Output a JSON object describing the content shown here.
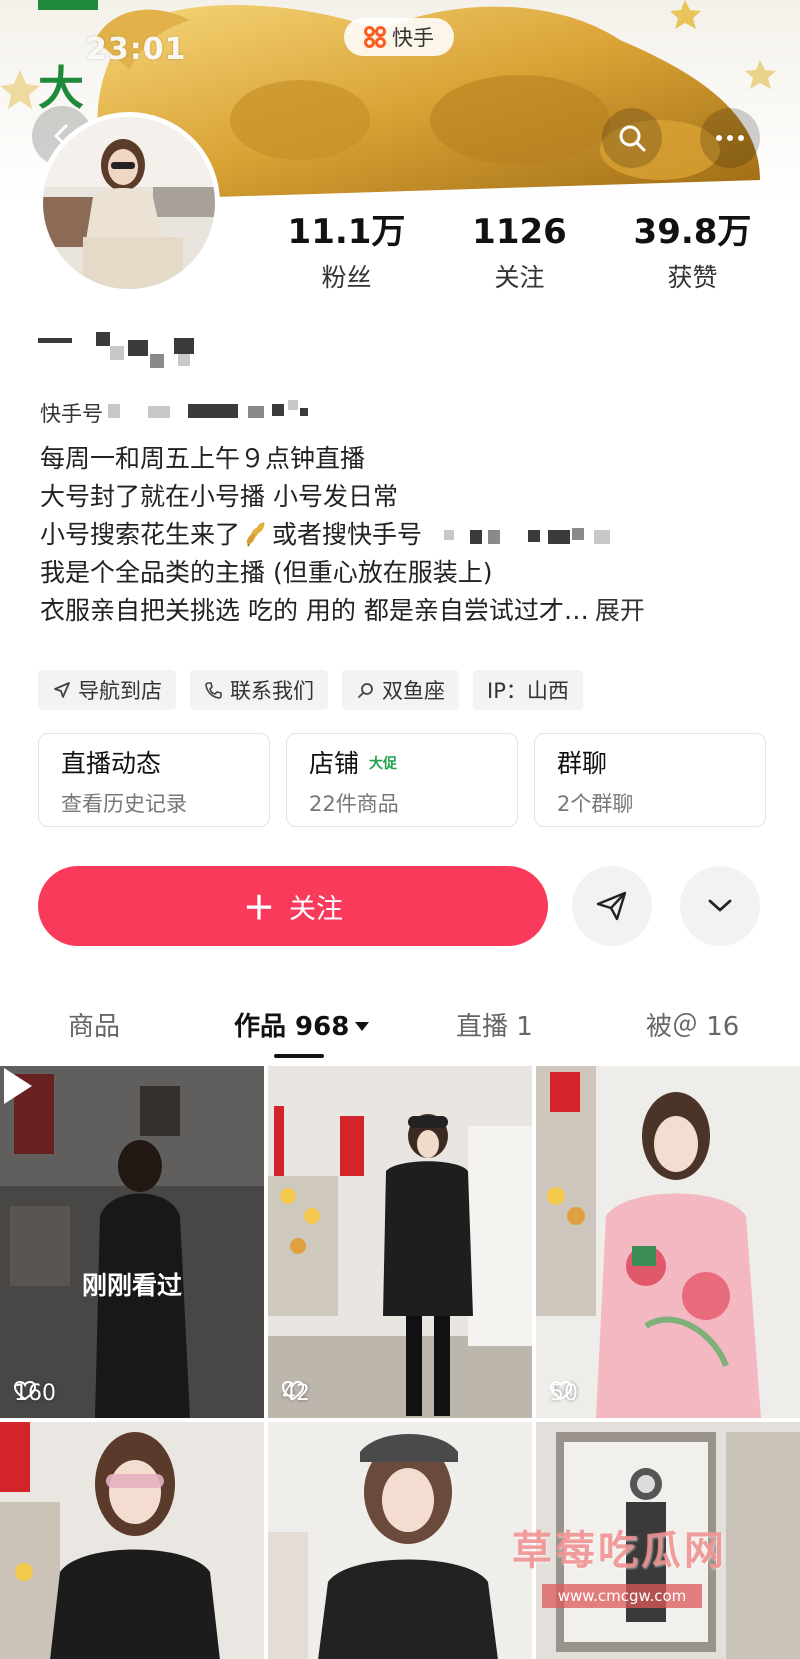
{
  "status_bar": {
    "time": "23:01"
  },
  "banner": {
    "char": "大",
    "app_badge": "快手"
  },
  "nav": {
    "back_icon": "chevron-left-icon",
    "search_icon": "search-icon",
    "more_icon": "more-dots-icon"
  },
  "stats": [
    {
      "value": "11.1万",
      "label": "粉丝"
    },
    {
      "value": "1126",
      "label": "关注"
    },
    {
      "value": "39.8万",
      "label": "获赞"
    }
  ],
  "profile": {
    "kuaishou_id_label": "快手号"
  },
  "bio": {
    "line1": "每周一和周五上午９点钟直播",
    "line2": "大号封了就在小号播 小号发日常",
    "line3_a": "小号搜索花生来了",
    "line3_b": "或者搜快手号",
    "line4": "我是个全品类的主播 (但重心放在服装上)",
    "line5": "衣服亲自把关挑选 吃的 用的 都是亲自尝试过才…",
    "expand": "展开"
  },
  "tags": [
    {
      "icon": "navigation-arrow-icon",
      "label": "导航到店"
    },
    {
      "icon": "phone-icon",
      "label": "联系我们"
    },
    {
      "icon": "zodiac-icon",
      "label": "双鱼座"
    },
    {
      "icon": "",
      "label": "IP：山西"
    }
  ],
  "cards": [
    {
      "title": "直播动态",
      "badge": "",
      "sub": "查看历史记录"
    },
    {
      "title": "店铺",
      "badge": "大促",
      "sub": "22件商品"
    },
    {
      "title": "群聊",
      "badge": "",
      "sub": "2个群聊"
    }
  ],
  "actions": {
    "follow_label": "关注",
    "follow_plus": "＋"
  },
  "tabs": [
    {
      "label": "商品"
    },
    {
      "label": "作品 968"
    },
    {
      "label": "直播 1"
    },
    {
      "label": "被＠ 16"
    }
  ],
  "videos": [
    {
      "likes": "160",
      "overlay": "刚刚看过"
    },
    {
      "likes": "42"
    },
    {
      "likes": "50"
    },
    {
      "likes": ""
    },
    {
      "likes": ""
    },
    {
      "likes": ""
    }
  ],
  "watermark": {
    "title": "草莓吃瓜网",
    "url": "www.cmcgw.com"
  },
  "colors": {
    "accent": "#f93a5b",
    "shop_badge": "#1ea34a",
    "logo": "#ff5a1f"
  }
}
